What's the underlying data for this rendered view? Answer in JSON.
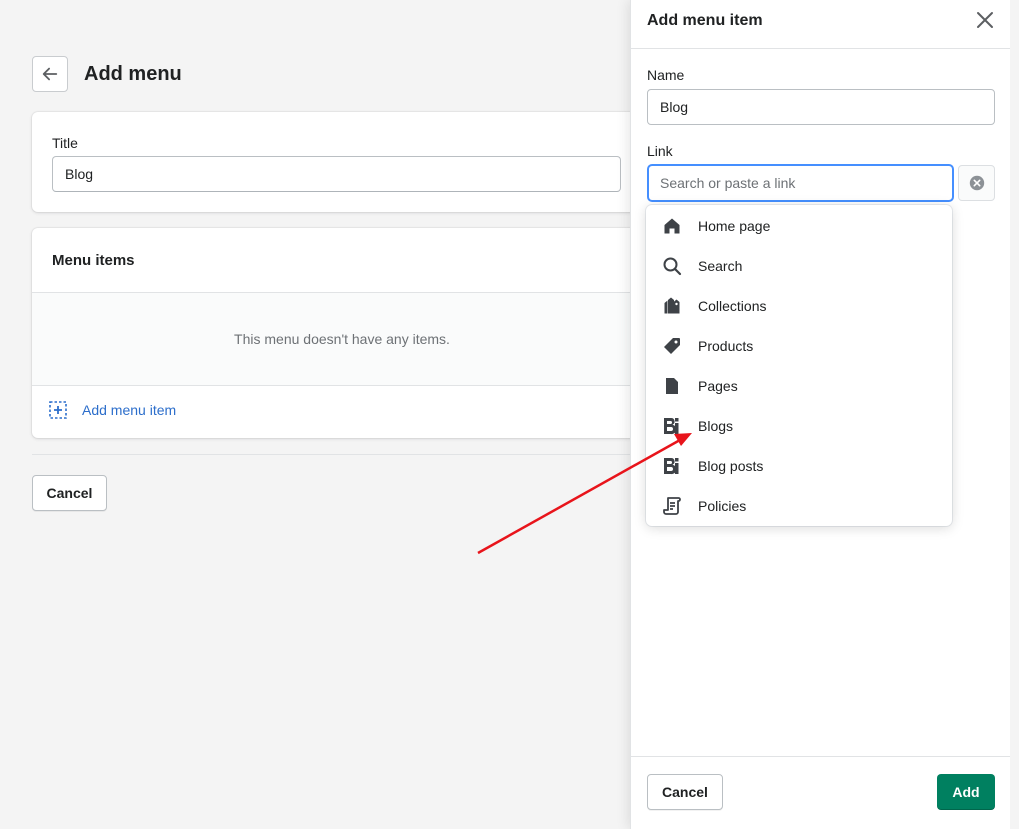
{
  "page": {
    "title": "Add menu",
    "title_card": {
      "label": "Title",
      "value": "Blog"
    },
    "menu_items_card": {
      "heading": "Menu items",
      "empty_text": "This menu doesn't have any items.",
      "add_label": "Add menu item"
    },
    "cancel_label": "Cancel"
  },
  "drawer": {
    "title": "Add menu item",
    "name_label": "Name",
    "name_value": "Blog",
    "link_label": "Link",
    "link_placeholder": "Search or paste a link",
    "cancel_label": "Cancel",
    "add_label": "Add",
    "add_color": "#008060"
  },
  "dropdown": {
    "items": [
      {
        "label": "Home page",
        "icon": "home-icon"
      },
      {
        "label": "Search",
        "icon": "search-icon"
      },
      {
        "label": "Collections",
        "icon": "collections-icon"
      },
      {
        "label": "Products",
        "icon": "tag-icon"
      },
      {
        "label": "Pages",
        "icon": "page-icon"
      },
      {
        "label": "Blogs",
        "icon": "blog-icon"
      },
      {
        "label": "Blog posts",
        "icon": "blog-posts-icon"
      },
      {
        "label": "Policies",
        "icon": "policy-icon"
      }
    ]
  },
  "annotation": {
    "arrow_color": "#e8141b"
  }
}
